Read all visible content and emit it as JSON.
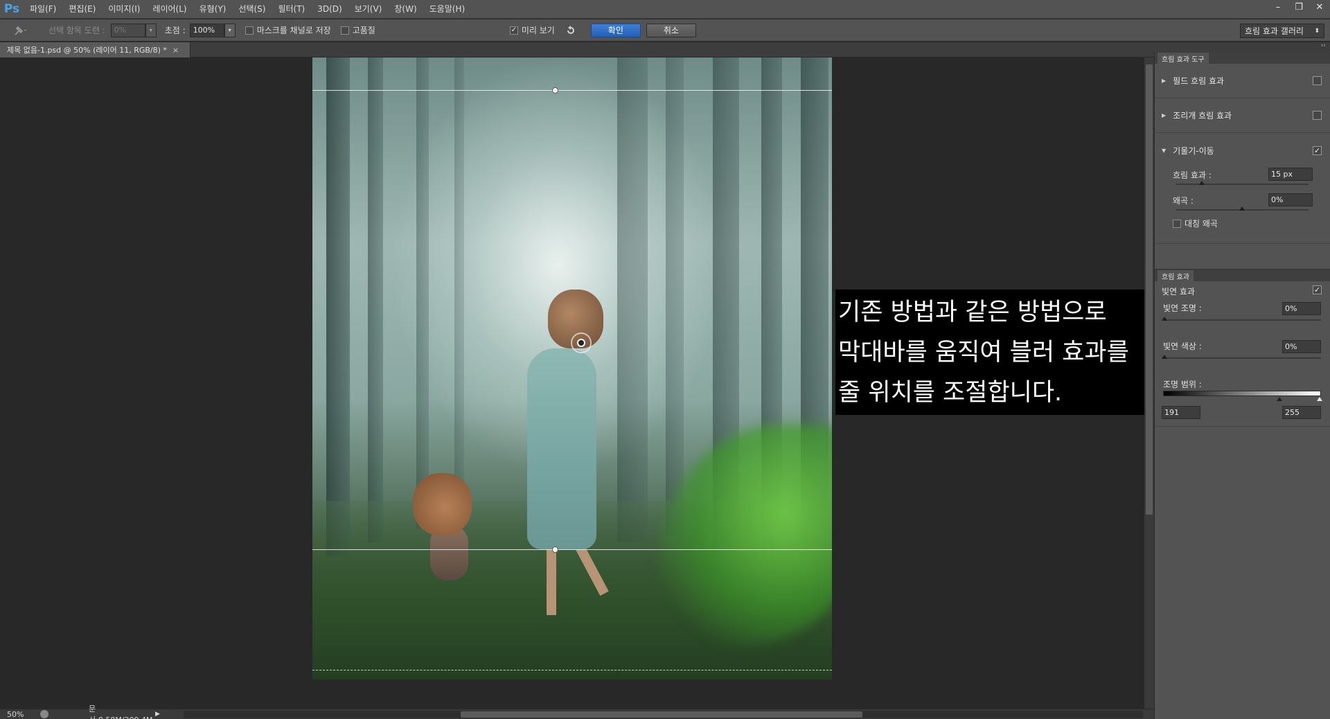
{
  "app": {
    "logo": "Ps",
    "menu": [
      "파일(F)",
      "편집(E)",
      "이미지(I)",
      "레이어(L)",
      "유형(Y)",
      "선택(S)",
      "필터(T)",
      "3D(D)",
      "보기(V)",
      "창(W)",
      "도움말(H)"
    ],
    "window_controls": [
      "–",
      "❐",
      "✕"
    ]
  },
  "options": {
    "tool_icon": "pin-tool-icon",
    "selection_bleed_label": "선택 항목 도련 :",
    "selection_bleed_value": "0%",
    "focus_label": "초점 :",
    "focus_value": "100%",
    "save_mask_label": "마스크를 채널로 저장",
    "save_mask_checked": false,
    "high_quality_label": "고품질",
    "high_quality_checked": false,
    "preview_label": "미리 보기",
    "preview_checked": true,
    "ok_label": "확인",
    "cancel_label": "취소",
    "workspace": "흐림 효과 갤러리"
  },
  "document": {
    "tab_title": "제목 없음-1.psd @ 50% (레이어 11, RGB/8) *",
    "tab_close": "×"
  },
  "caption": {
    "lines": [
      "기존 방법과 같은 방법으로",
      "막대바를 움직여 블러 효과를",
      "줄 위치를 조절합니다."
    ]
  },
  "status": {
    "zoom": "50%",
    "doc_size": "문서:8.58M/209.4M"
  },
  "blur_tools": {
    "tab_label": "흐림 효과 도구",
    "items": [
      {
        "label": "필드 흐림 효과",
        "expanded": false,
        "checked": false
      },
      {
        "label": "조리개 흐림 효과",
        "expanded": false,
        "checked": false
      },
      {
        "label": "기울기-이동",
        "expanded": true,
        "checked": true
      }
    ],
    "tilt_shift": {
      "blur_label": "흐림 효과 :",
      "blur_value": "15 px",
      "blur_level": 0.2,
      "distortion_label": "왜곡 :",
      "distortion_value": "0%",
      "distortion_level": 0.5,
      "symmetric_label": "대칭 왜곡",
      "symmetric_checked": false
    }
  },
  "blur_effects": {
    "tab_label": "흐림 효과",
    "bokeh_label": "빛연 효과",
    "bokeh_checked": true,
    "light_bokeh_label": "빛연 조명 :",
    "light_bokeh_value": "0%",
    "bokeh_color_label": "빛연 색상 :",
    "bokeh_color_value": "0%",
    "light_range_label": "조명 범위 :",
    "light_range_min": "191",
    "light_range_max": "255"
  },
  "colors": {
    "accent": "#2f6fc8",
    "panel": "#535353",
    "canvas_bg": "#282828"
  }
}
